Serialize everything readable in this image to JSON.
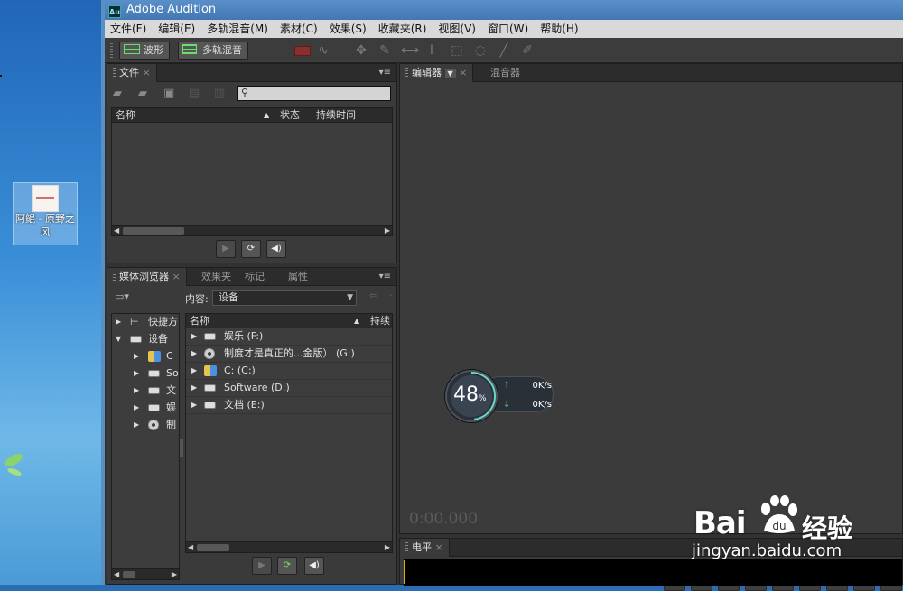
{
  "desktop": {
    "icon_label": "阿鲲 - 原野之风"
  },
  "app": {
    "title": "Adobe Audition",
    "logo_text": "Au"
  },
  "menubar": [
    "文件(F)",
    "编辑(E)",
    "多轨混音(M)",
    "素材(C)",
    "效果(S)",
    "收藏夹(R)",
    "视图(V)",
    "窗口(W)",
    "帮助(H)"
  ],
  "toolbar": {
    "waveform_label": "波形",
    "multitrack_label": "多轨混音"
  },
  "files_panel": {
    "tab": "文件",
    "columns": [
      "名称",
      "状态",
      "持续时间"
    ]
  },
  "media_panel": {
    "tabs": [
      "媒体浏览器",
      "效果夹",
      "标记",
      "属性"
    ],
    "content_label": "内容:",
    "content_value": "设备",
    "tree": [
      {
        "label": "快捷方",
        "expanded": false
      },
      {
        "label": "设备",
        "expanded": true
      },
      {
        "label": "C",
        "expanded": false
      },
      {
        "label": "So",
        "expanded": false
      },
      {
        "label": "文",
        "expanded": false
      },
      {
        "label": "娱",
        "expanded": false
      },
      {
        "label": "制",
        "expanded": false
      }
    ],
    "list_columns": [
      "名称",
      "持续"
    ],
    "rows": [
      {
        "name": "娱乐 (F:)",
        "icon": "drive-icon"
      },
      {
        "name": "制度才是真正的...金版） (G:)",
        "icon": "disc-icon"
      },
      {
        "name": "C: (C:)",
        "icon": "network-drive-icon"
      },
      {
        "name": "Software (D:)",
        "icon": "drive-icon"
      },
      {
        "name": "文档 (E:)",
        "icon": "drive-icon"
      }
    ]
  },
  "editor": {
    "tabs": [
      "编辑器",
      "混音器"
    ],
    "time": "0:00.000"
  },
  "levels_panel": {
    "tab": "电平"
  },
  "gauge": {
    "percent": "48",
    "percent_sign": "%",
    "up_speed": "0K/s",
    "down_speed": "0K/s",
    "up_arrow": "↑",
    "down_arrow": "↓",
    "arc_color": "#6ad7c4"
  },
  "watermark": {
    "brand": "Bai",
    "brand_tail": "经验",
    "url": "jingyan.baidu.com"
  }
}
